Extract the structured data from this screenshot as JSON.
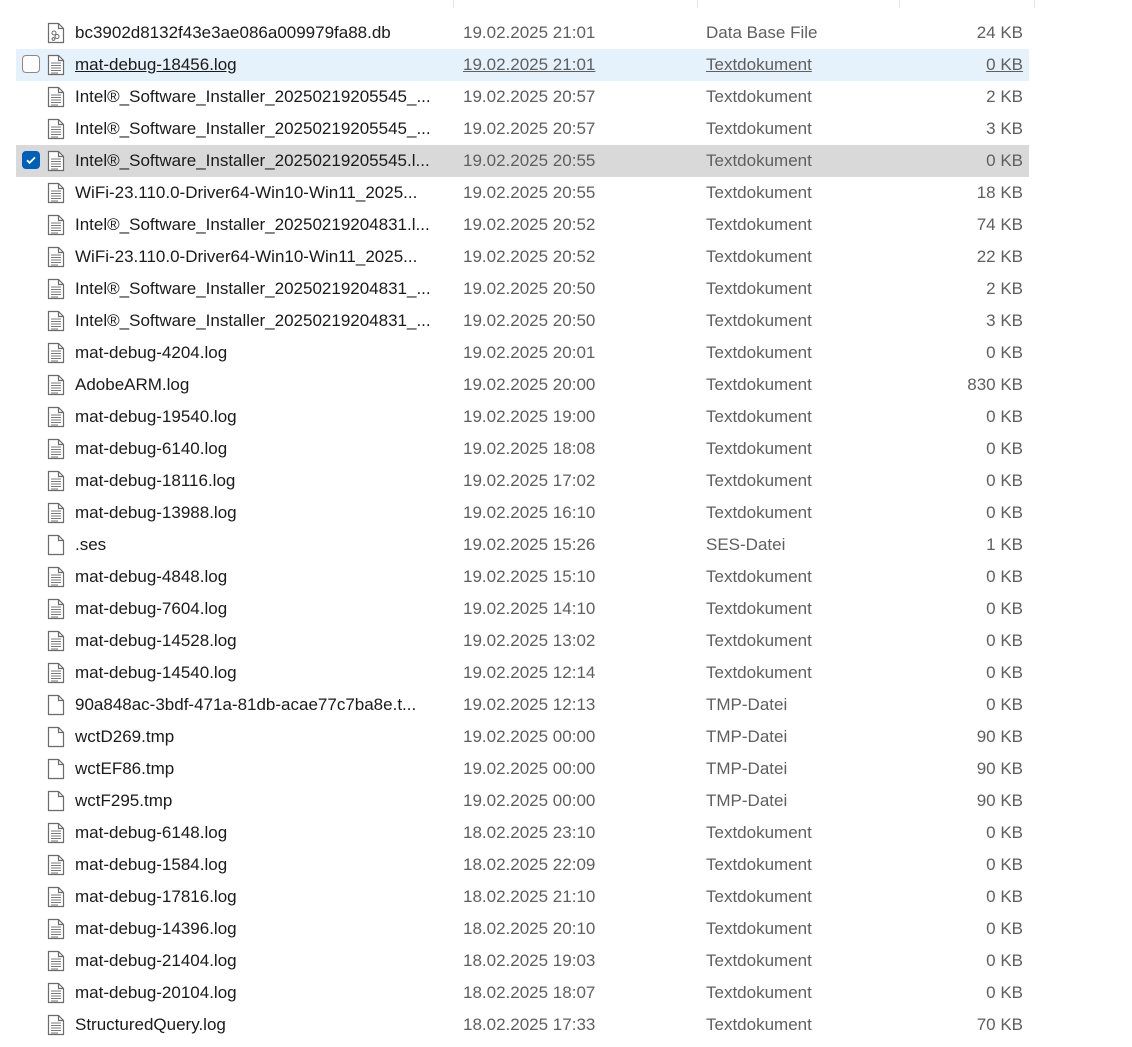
{
  "files": [
    {
      "name": "bc3902d8132f43e3ae086a009979fa88.db",
      "date": "19.02.2025 21:01",
      "type": "Data Base File",
      "size": "24 KB",
      "icon": "db-file-icon",
      "state": ""
    },
    {
      "name": "mat-debug-18456.log",
      "date": "19.02.2025 21:01",
      "type": "Textdokument",
      "size": "0 KB",
      "icon": "text-file-icon",
      "state": "hover"
    },
    {
      "name": "Intel®_Software_Installer_20250219205545_...",
      "date": "19.02.2025 20:57",
      "type": "Textdokument",
      "size": "2 KB",
      "icon": "text-file-icon",
      "state": ""
    },
    {
      "name": "Intel®_Software_Installer_20250219205545_...",
      "date": "19.02.2025 20:57",
      "type": "Textdokument",
      "size": "3 KB",
      "icon": "text-file-icon",
      "state": ""
    },
    {
      "name": "Intel®_Software_Installer_20250219205545.l...",
      "date": "19.02.2025 20:55",
      "type": "Textdokument",
      "size": "0 KB",
      "icon": "text-file-icon",
      "state": "selected"
    },
    {
      "name": "WiFi-23.110.0-Driver64-Win10-Win11_2025...",
      "date": "19.02.2025 20:55",
      "type": "Textdokument",
      "size": "18 KB",
      "icon": "text-file-icon",
      "state": ""
    },
    {
      "name": "Intel®_Software_Installer_20250219204831.l...",
      "date": "19.02.2025 20:52",
      "type": "Textdokument",
      "size": "74 KB",
      "icon": "text-file-icon",
      "state": ""
    },
    {
      "name": "WiFi-23.110.0-Driver64-Win10-Win11_2025...",
      "date": "19.02.2025 20:52",
      "type": "Textdokument",
      "size": "22 KB",
      "icon": "text-file-icon",
      "state": ""
    },
    {
      "name": "Intel®_Software_Installer_20250219204831_...",
      "date": "19.02.2025 20:50",
      "type": "Textdokument",
      "size": "2 KB",
      "icon": "text-file-icon",
      "state": ""
    },
    {
      "name": "Intel®_Software_Installer_20250219204831_...",
      "date": "19.02.2025 20:50",
      "type": "Textdokument",
      "size": "3 KB",
      "icon": "text-file-icon",
      "state": ""
    },
    {
      "name": "mat-debug-4204.log",
      "date": "19.02.2025 20:01",
      "type": "Textdokument",
      "size": "0 KB",
      "icon": "text-file-icon",
      "state": ""
    },
    {
      "name": "AdobeARM.log",
      "date": "19.02.2025 20:00",
      "type": "Textdokument",
      "size": "830 KB",
      "icon": "text-file-icon",
      "state": ""
    },
    {
      "name": "mat-debug-19540.log",
      "date": "19.02.2025 19:00",
      "type": "Textdokument",
      "size": "0 KB",
      "icon": "text-file-icon",
      "state": ""
    },
    {
      "name": "mat-debug-6140.log",
      "date": "19.02.2025 18:08",
      "type": "Textdokument",
      "size": "0 KB",
      "icon": "text-file-icon",
      "state": ""
    },
    {
      "name": "mat-debug-18116.log",
      "date": "19.02.2025 17:02",
      "type": "Textdokument",
      "size": "0 KB",
      "icon": "text-file-icon",
      "state": ""
    },
    {
      "name": "mat-debug-13988.log",
      "date": "19.02.2025 16:10",
      "type": "Textdokument",
      "size": "0 KB",
      "icon": "text-file-icon",
      "state": ""
    },
    {
      "name": ".ses",
      "date": "19.02.2025 15:26",
      "type": "SES-Datei",
      "size": "1 KB",
      "icon": "blank-file-icon",
      "state": ""
    },
    {
      "name": "mat-debug-4848.log",
      "date": "19.02.2025 15:10",
      "type": "Textdokument",
      "size": "0 KB",
      "icon": "text-file-icon",
      "state": ""
    },
    {
      "name": "mat-debug-7604.log",
      "date": "19.02.2025 14:10",
      "type": "Textdokument",
      "size": "0 KB",
      "icon": "text-file-icon",
      "state": ""
    },
    {
      "name": "mat-debug-14528.log",
      "date": "19.02.2025 13:02",
      "type": "Textdokument",
      "size": "0 KB",
      "icon": "text-file-icon",
      "state": ""
    },
    {
      "name": "mat-debug-14540.log",
      "date": "19.02.2025 12:14",
      "type": "Textdokument",
      "size": "0 KB",
      "icon": "text-file-icon",
      "state": ""
    },
    {
      "name": "90a848ac-3bdf-471a-81db-acae77c7ba8e.t...",
      "date": "19.02.2025 12:13",
      "type": "TMP-Datei",
      "size": "0 KB",
      "icon": "blank-file-icon",
      "state": ""
    },
    {
      "name": "wctD269.tmp",
      "date": "19.02.2025 00:00",
      "type": "TMP-Datei",
      "size": "90 KB",
      "icon": "blank-file-icon",
      "state": ""
    },
    {
      "name": "wctEF86.tmp",
      "date": "19.02.2025 00:00",
      "type": "TMP-Datei",
      "size": "90 KB",
      "icon": "blank-file-icon",
      "state": ""
    },
    {
      "name": "wctF295.tmp",
      "date": "19.02.2025 00:00",
      "type": "TMP-Datei",
      "size": "90 KB",
      "icon": "blank-file-icon",
      "state": ""
    },
    {
      "name": "mat-debug-6148.log",
      "date": "18.02.2025 23:10",
      "type": "Textdokument",
      "size": "0 KB",
      "icon": "text-file-icon",
      "state": ""
    },
    {
      "name": "mat-debug-1584.log",
      "date": "18.02.2025 22:09",
      "type": "Textdokument",
      "size": "0 KB",
      "icon": "text-file-icon",
      "state": ""
    },
    {
      "name": "mat-debug-17816.log",
      "date": "18.02.2025 21:10",
      "type": "Textdokument",
      "size": "0 KB",
      "icon": "text-file-icon",
      "state": ""
    },
    {
      "name": "mat-debug-14396.log",
      "date": "18.02.2025 20:10",
      "type": "Textdokument",
      "size": "0 KB",
      "icon": "text-file-icon",
      "state": ""
    },
    {
      "name": "mat-debug-21404.log",
      "date": "18.02.2025 19:03",
      "type": "Textdokument",
      "size": "0 KB",
      "icon": "text-file-icon",
      "state": ""
    },
    {
      "name": "mat-debug-20104.log",
      "date": "18.02.2025 18:07",
      "type": "Textdokument",
      "size": "0 KB",
      "icon": "text-file-icon",
      "state": ""
    },
    {
      "name": "StructuredQuery.log",
      "date": "18.02.2025 17:33",
      "type": "Textdokument",
      "size": "70 KB",
      "icon": "text-file-icon",
      "state": ""
    }
  ],
  "colors": {
    "hover_bg": "#e5f1fb",
    "selected_bg": "#d9d9d9",
    "checkbox_accent": "#005fb8"
  }
}
